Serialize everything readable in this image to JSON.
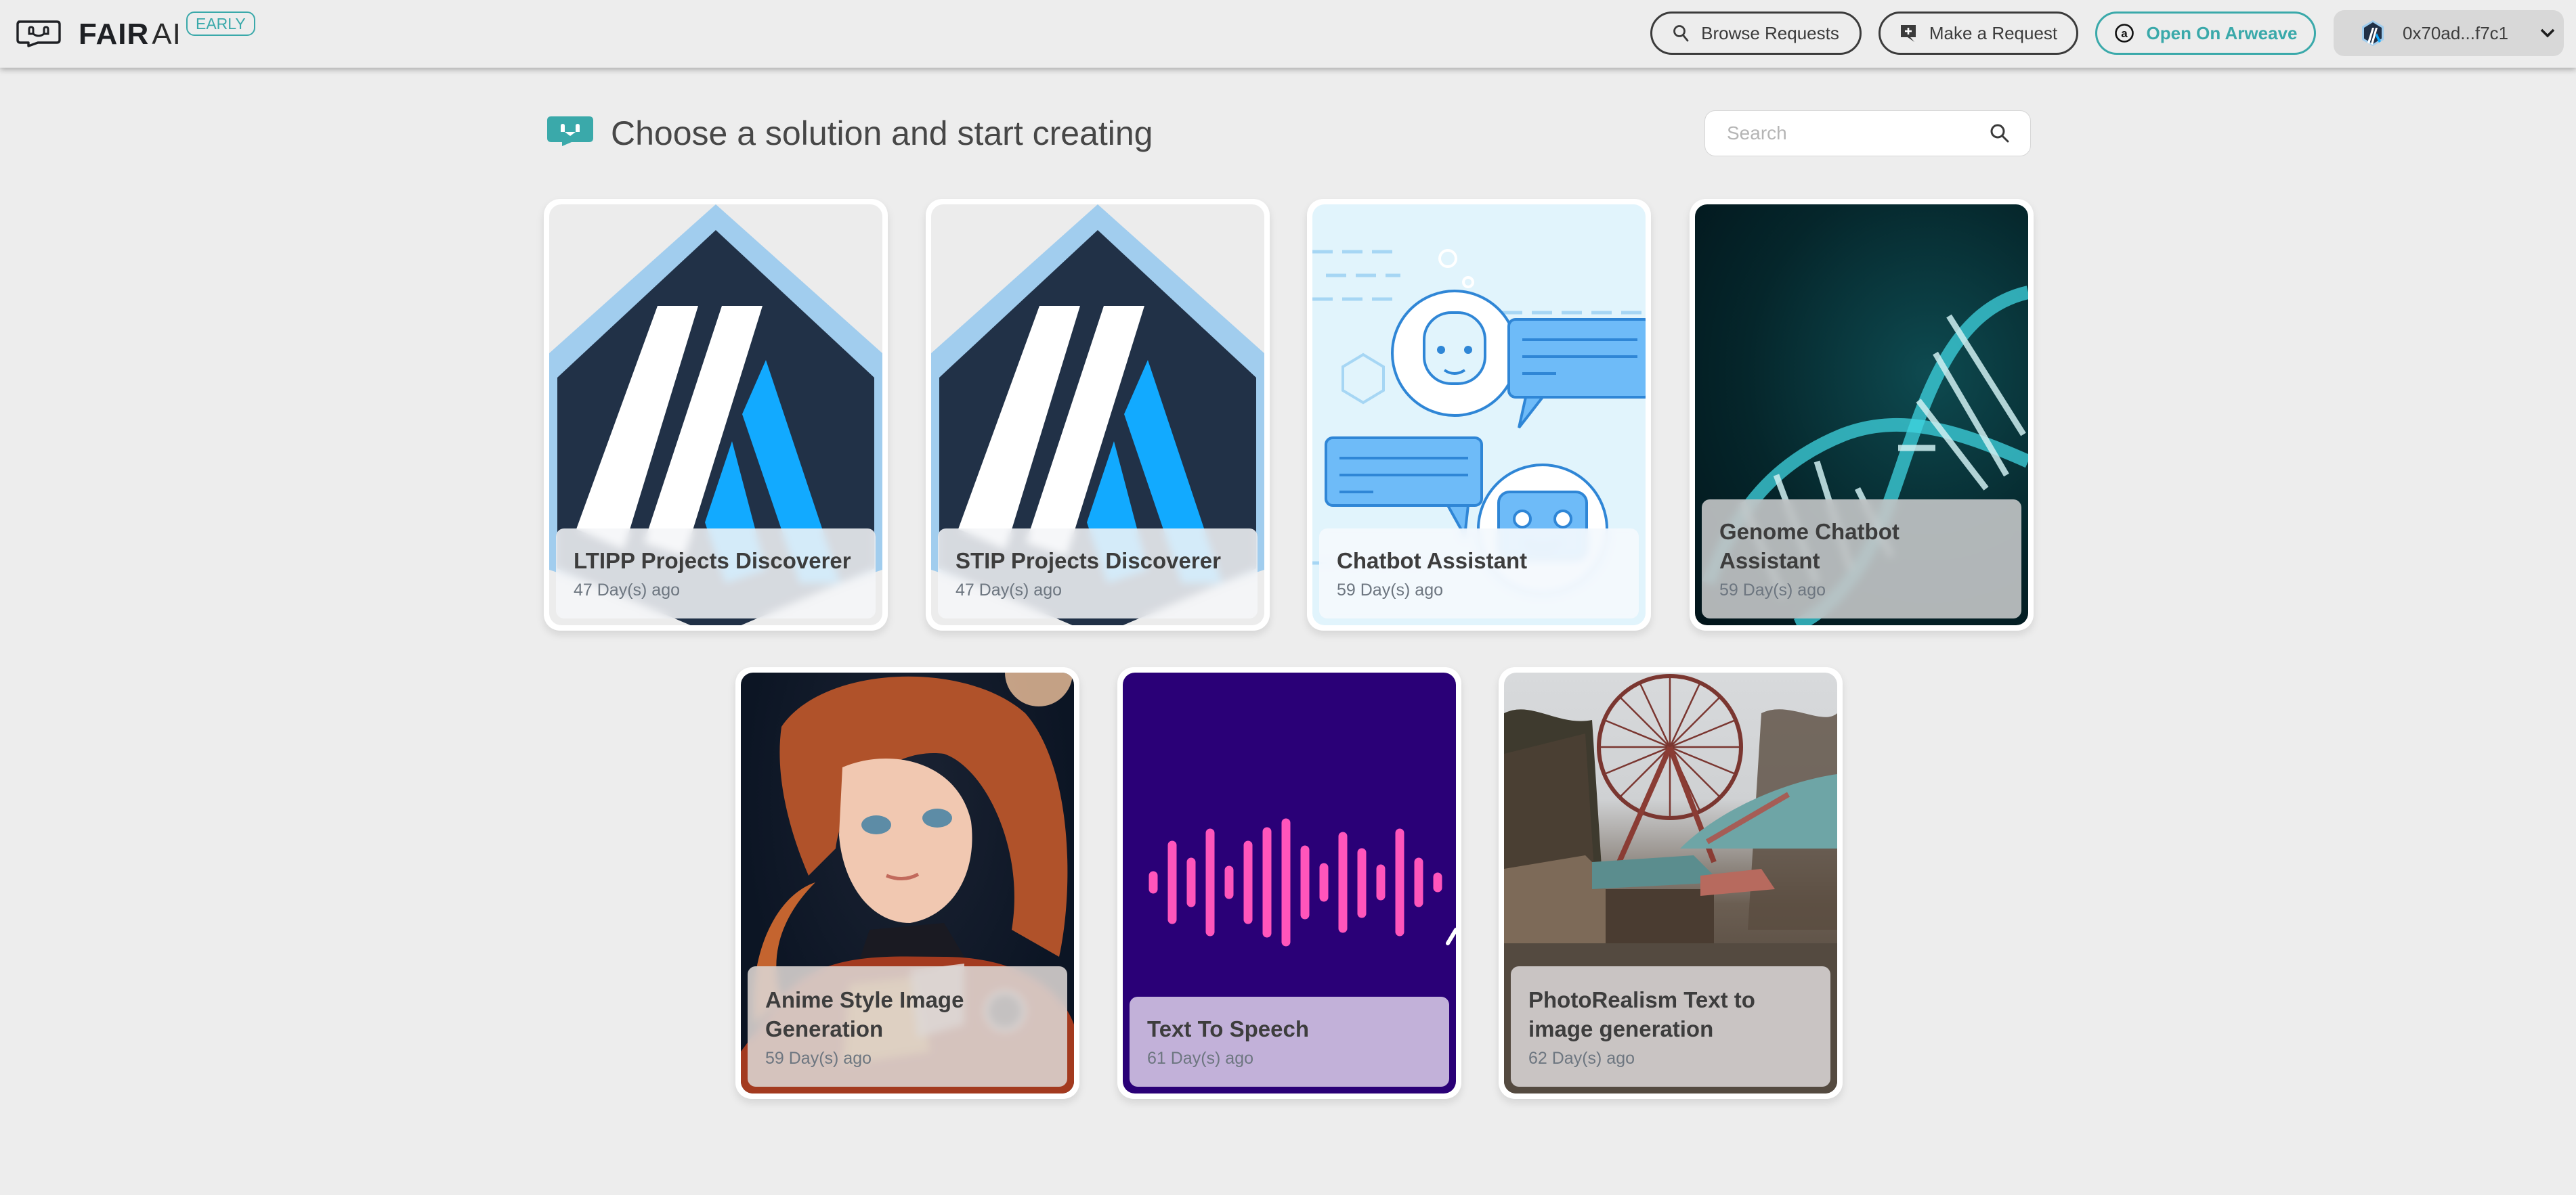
{
  "header": {
    "brand_bold": "FAIR",
    "brand_thin": "AI",
    "badge": "EARLY",
    "buttons": {
      "browse": "Browse Requests",
      "make": "Make a Request",
      "arweave": "Open On Arweave"
    },
    "wallet": {
      "address": "0x70ad...f7c1",
      "icon": "arbitrum-icon"
    }
  },
  "main": {
    "title": "Choose a solution and start creating",
    "search": {
      "placeholder": "Search",
      "value": ""
    },
    "solutions": [
      {
        "title": "LTIPP Projects Discoverer",
        "date": "47 Day(s) ago",
        "image": "arbitrum-logo"
      },
      {
        "title": "STIP Projects Discoverer",
        "date": "47 Day(s) ago",
        "image": "arbitrum-logo"
      },
      {
        "title": "Chatbot Assistant",
        "date": "59 Day(s) ago",
        "image": "chatbot-illustration"
      },
      {
        "title": "Genome Chatbot Assistant",
        "date": "59 Day(s) ago",
        "image": "dna-helix"
      },
      {
        "title": "Anime Style Image Generation",
        "date": "59 Day(s) ago",
        "image": "anime-portrait"
      },
      {
        "title": "Text To Speech",
        "date": "61 Day(s) ago",
        "image": "sound-wave"
      },
      {
        "title": "PhotoRealism Text to image generation",
        "date": "62 Day(s) ago",
        "image": "ferris-wheel-photo"
      }
    ]
  },
  "colors": {
    "accent": "#3aa9aa",
    "background": "#ededed",
    "tts_background": "#2a0077",
    "tts_wave": "#ff55bb"
  }
}
